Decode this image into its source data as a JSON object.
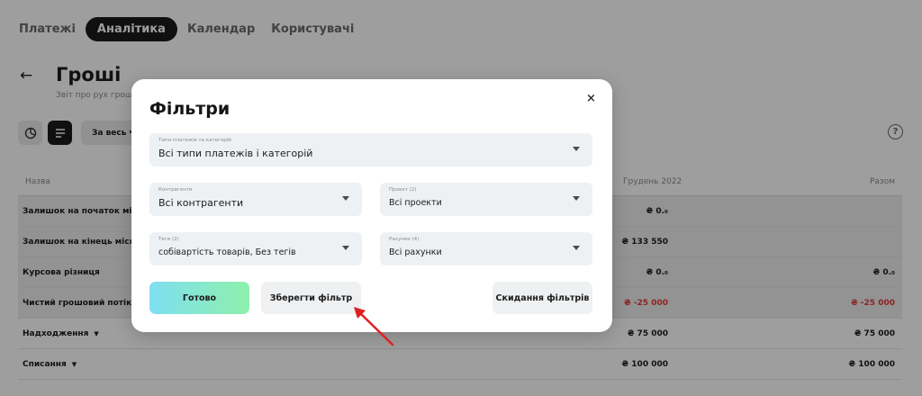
{
  "nav": {
    "tabs": [
      {
        "label": "Платежі"
      },
      {
        "label": "Аналітика"
      },
      {
        "label": "Календар"
      },
      {
        "label": "Користувачі"
      }
    ]
  },
  "page": {
    "title": "Гроші",
    "subtitle": "Звіт про рух грошо",
    "period_label": "За весь час",
    "help_symbol": "?"
  },
  "table": {
    "columns": {
      "name": "Назва",
      "december": "Грудень 2022",
      "total": "Разом"
    },
    "rows": [
      {
        "name": "Залишок на початок місяця",
        "december": "₴ 0.₀",
        "total": ""
      },
      {
        "name": "Залишок на кінець місяця",
        "december": "₴ 133 550",
        "total": ""
      },
      {
        "name": "Курсова різниця",
        "december": "₴ 0.₀",
        "total": "₴ 0.₀"
      },
      {
        "name": "Чистий грошовий потік",
        "december": "₴ -25 000",
        "total": "₴ -25 000"
      },
      {
        "name": "Надходження",
        "december": "₴ 75 000",
        "total": "₴ 75 000"
      },
      {
        "name": "Списання",
        "december": "₴ 100 000",
        "total": "₴ 100 000"
      }
    ]
  },
  "modal": {
    "title": "Фільтри",
    "close_symbol": "×",
    "fields": {
      "payment_types": {
        "label": "Типи платежів та категорій",
        "value": "Всі типи платежів і категорій"
      },
      "contractors": {
        "label": "Контрагенти",
        "value": "Всі контрагенти"
      },
      "projects": {
        "label": "Проект (2)",
        "value": "Всі проекти"
      },
      "tags": {
        "label": "Теги (2)",
        "value": "собівартість товарів, Без тегів"
      },
      "accounts": {
        "label": "Рахунки (4)",
        "value": "Всі рахунки"
      }
    },
    "buttons": {
      "done": "Готово",
      "save_filter": "Зберегти фільтр",
      "reset_filters": "Скидання фільтрів"
    }
  },
  "colors": {
    "accent_dark": "#1b1b1b",
    "negative": "#e23b3b",
    "arrow": "#e02020",
    "primary_gradient_start": "#7fdff0",
    "primary_gradient_end": "#8ef0ac"
  },
  "icons": [
    "back-arrow-icon",
    "pie-chart-icon",
    "list-view-icon",
    "help-icon",
    "close-icon",
    "chevron-down-icon"
  ]
}
